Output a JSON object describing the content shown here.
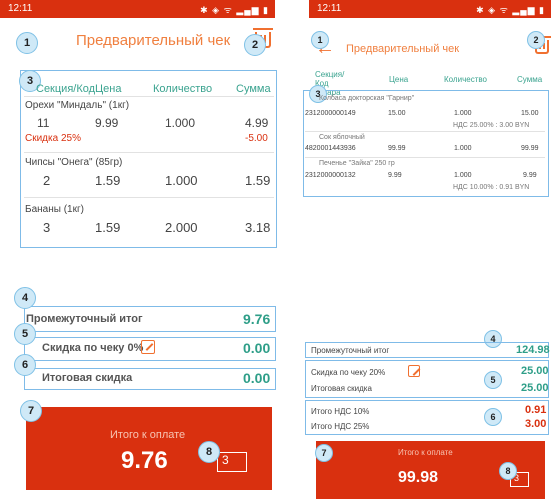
{
  "left": {
    "status": {
      "time": "12:11",
      "icons": "✱ ◈ ᯤ ▂▄▆ ▮"
    },
    "title": "Предварительный чек",
    "table": {
      "headers": [
        "Секция/Код",
        "Цена",
        "Количество",
        "Сумма"
      ],
      "items": [
        {
          "name": "Орехи \"Миндаль\" (1кг)",
          "code": "11",
          "price": "9.99",
          "qty": "1.000",
          "sum": "4.99",
          "discount_label": "Скидка 25%",
          "discount_value": "-5.00"
        },
        {
          "name": "Чипсы \"Онега\" (85гр)",
          "code": "2",
          "price": "1.59",
          "qty": "1.000",
          "sum": "1.59"
        },
        {
          "name": "Бананы (1кг)",
          "code": "3",
          "price": "1.59",
          "qty": "2.000",
          "sum": "3.18"
        }
      ]
    },
    "summary": {
      "subtotal_label": "Промежуточный итог",
      "subtotal_value": "9.76",
      "check_discount_label": "Скидка по чеку 0%",
      "check_discount_value": "0.00",
      "total_discount_label": "Итоговая скидка",
      "total_discount_value": "0.00"
    },
    "pay": {
      "label": "Итого к оплате",
      "amount": "9.76",
      "count": "3"
    },
    "badges": [
      "1",
      "2",
      "3",
      "4",
      "5",
      "6",
      "7",
      "8"
    ]
  },
  "right": {
    "status": {
      "time": "12:11",
      "icons": "✱ ◈ ᯤ ▂▄▆ ▮"
    },
    "title": "Предварительный чек",
    "table": {
      "headers": [
        "Секция/ Код товара",
        "Цена",
        "Количество",
        "Сумма"
      ],
      "items": [
        {
          "name": "Колбаса докторская \"Гарнир\"",
          "code": "2312000000149",
          "price": "15.00",
          "qty": "1.000",
          "sum": "15.00",
          "vat": "НДС 25.00% : 3.00 BYN"
        },
        {
          "name": "Сок яблочный",
          "code": "4820001443936",
          "price": "99.99",
          "qty": "1.000",
          "sum": "99.99"
        },
        {
          "name": "Печенье \"Зайка\" 250 гр",
          "code": "2312000000132",
          "price": "9.99",
          "qty": "1.000",
          "sum": "9.99",
          "vat": "НДС 10.00% : 0.91 BYN"
        }
      ]
    },
    "summary": {
      "subtotal_label": "Промежуточный итог",
      "subtotal_value": "124.98",
      "check_discount_label": "Скидка по чеку 20%",
      "check_discount_value": "25.00",
      "total_discount_label": "Итоговая скидка",
      "total_discount_value": "25.00",
      "vat10_label": "Итого НДС 10%",
      "vat10_value": "0.91",
      "vat25_label": "Итого НДС 25%",
      "vat25_value": "3.00"
    },
    "pay": {
      "label": "Итого к оплате",
      "amount": "99.98",
      "count": "3"
    },
    "badges": [
      "1",
      "2",
      "3",
      "4",
      "5",
      "6",
      "7",
      "8"
    ]
  }
}
